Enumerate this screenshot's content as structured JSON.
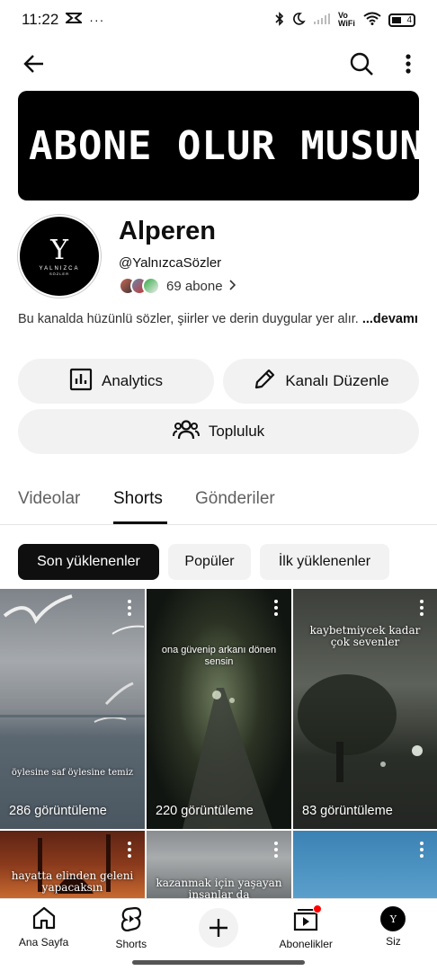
{
  "status": {
    "time": "11:22",
    "network": "Vo WiFi",
    "battery": "4"
  },
  "channel": {
    "banner_text": "ABONE OLUR MUSUN?",
    "name": "Alperen",
    "handle": "@YalnızcaSözler",
    "subscribers": "69 abone",
    "avatar_letter": "Y",
    "avatar_brand": "YALNIZCA",
    "avatar_sub": "SÖZLER",
    "description": "Bu kanalda hüzünlü sözler, şiirler ve derin duygular yer alır.",
    "more_label": "...devamı"
  },
  "buttons": {
    "analytics": "Analytics",
    "edit": "Kanalı Düzenle",
    "community": "Topluluk"
  },
  "tabs": [
    {
      "label": "Videolar"
    },
    {
      "label": "Shorts"
    },
    {
      "label": "Gönderiler"
    }
  ],
  "chips": [
    {
      "label": "Son yüklenenler"
    },
    {
      "label": "Popüler"
    },
    {
      "label": "İlk yüklenenler"
    }
  ],
  "shorts": [
    {
      "caption": "öylesine saf öylesine temiz",
      "views": "286 görüntüleme"
    },
    {
      "caption": "ona güvenip arkanı dönen sensin",
      "views": "220 görüntüleme"
    },
    {
      "caption": "kaybetmiycek kadar çok sevenler",
      "views": "83 görüntüleme"
    },
    {
      "caption": "hayatta elinden geleni yapacaksın",
      "views": ""
    },
    {
      "caption": "kazanmak için yaşayan insanlar da",
      "views": ""
    },
    {
      "caption": "",
      "views": ""
    }
  ],
  "nav": {
    "home": "Ana Sayfa",
    "shorts": "Shorts",
    "subscriptions": "Abonelikler",
    "you": "Siz"
  },
  "colors": {
    "accent": "#0f0f0f",
    "chip_bg": "#f2f2f2",
    "notification": "#ff0000"
  }
}
